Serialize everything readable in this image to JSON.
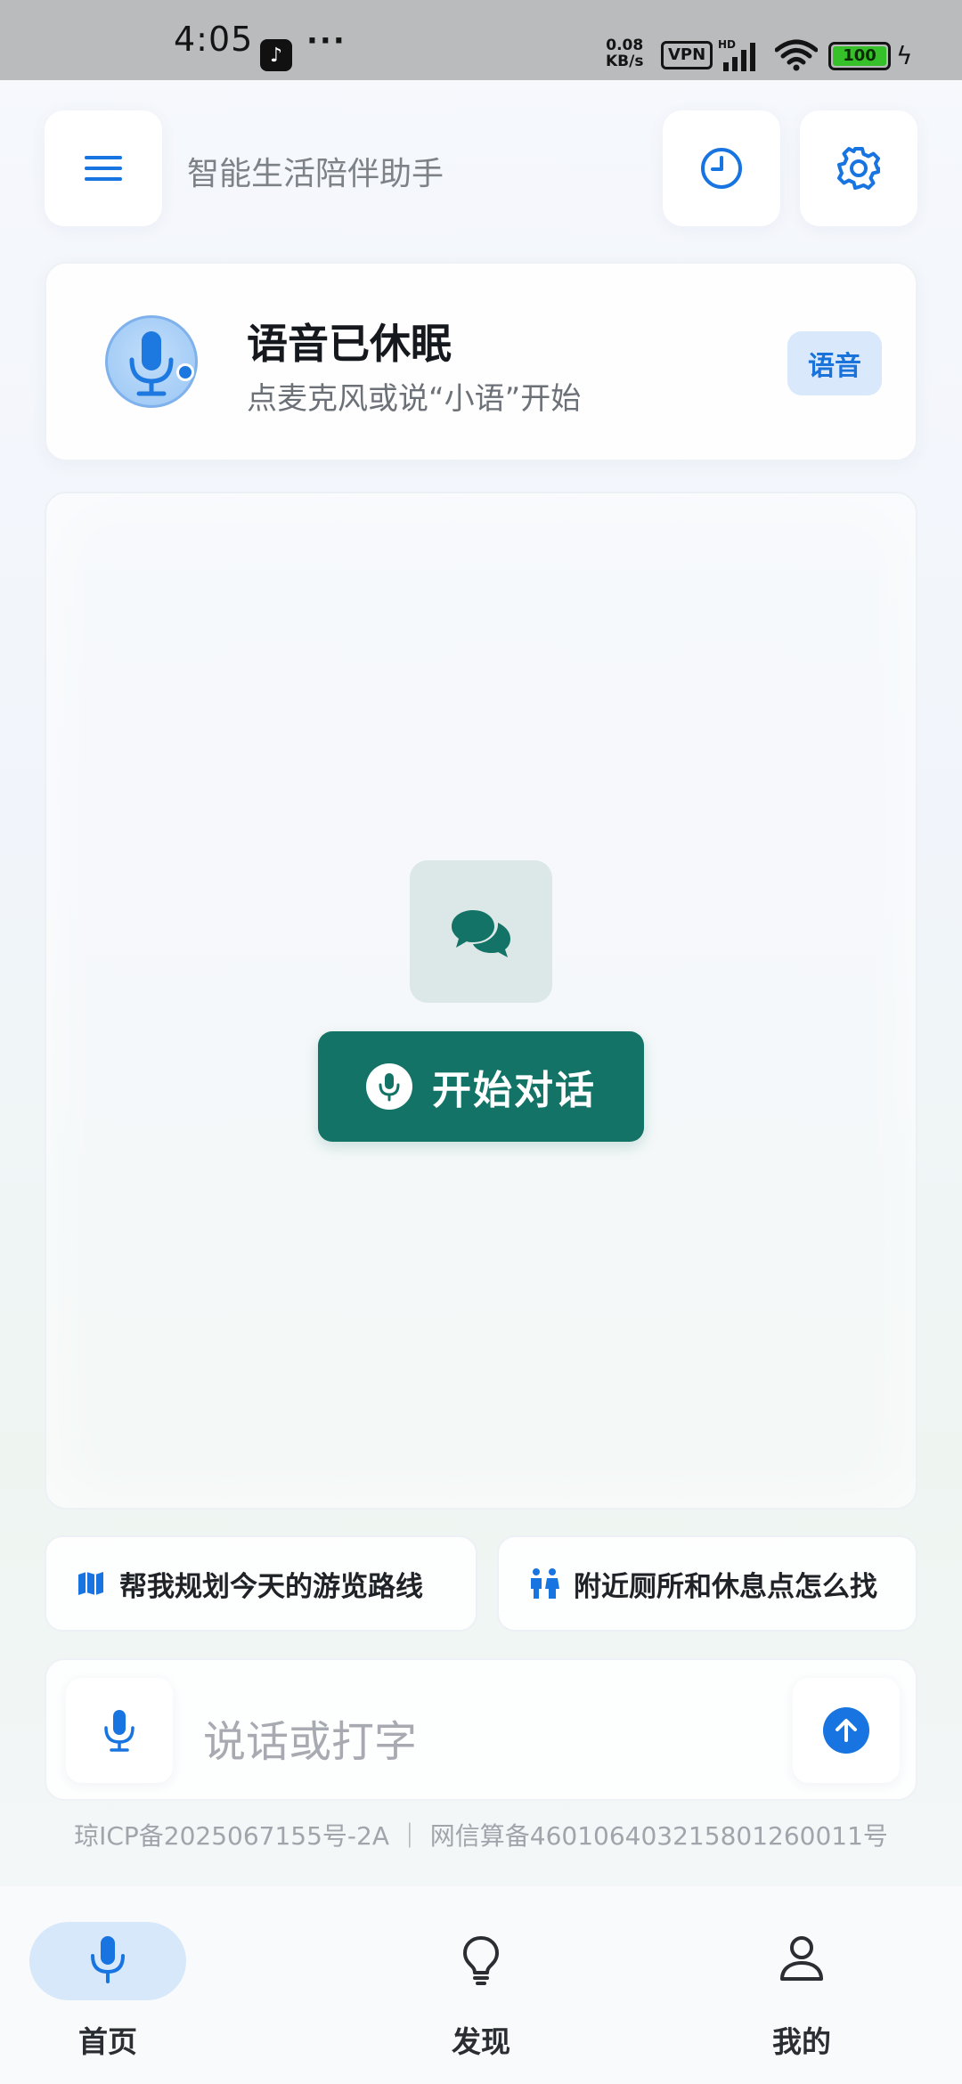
{
  "status_bar": {
    "time": "4:05",
    "app_icon": "tiktok-icon",
    "more": "···",
    "net_speed_value": "0.08",
    "net_speed_unit": "KB/s",
    "vpn": "VPN",
    "signal_label": "HD",
    "battery": "100"
  },
  "header": {
    "title": "智能生活陪伴助手",
    "menu_icon": "menu-icon",
    "history_icon": "clock-icon",
    "settings_icon": "gear-icon"
  },
  "voice_card": {
    "title": "语音已休眠",
    "subtitle": "点麦克风或说“小语”开始",
    "badge": "语音"
  },
  "main": {
    "start_button": "开始对话",
    "chat_icon": "chat-bubbles-icon"
  },
  "suggestions": [
    {
      "label": "帮我规划今天的游览路线",
      "icon": "map-icon"
    },
    {
      "label": "附近厕所和休息点怎么找",
      "icon": "restroom-icon"
    }
  ],
  "input": {
    "placeholder": "说话或打字",
    "mic_icon": "microphone-icon",
    "send_icon": "send-arrow-icon"
  },
  "footer": {
    "icp": "琼ICP备2025067155号-2A ｜ 网信算备460106403215801260011号"
  },
  "nav": {
    "items": [
      {
        "label": "首页",
        "icon": "microphone-icon",
        "active": true
      },
      {
        "label": "发现",
        "icon": "lightbulb-icon",
        "active": false
      },
      {
        "label": "我的",
        "icon": "user-icon",
        "active": false
      }
    ]
  },
  "colors": {
    "accent": "#1874e0",
    "teal": "#137366",
    "badge_bg": "#d9e9fb"
  }
}
